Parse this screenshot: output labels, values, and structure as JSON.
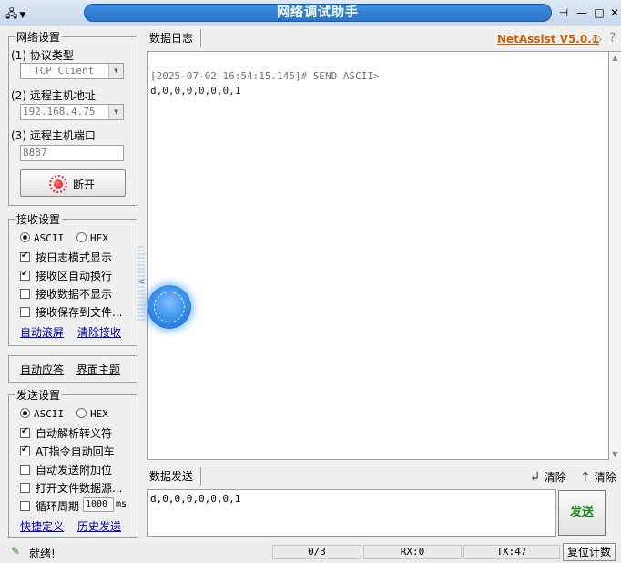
{
  "window": {
    "title": "网络调试助手"
  },
  "network_settings": {
    "group_title": "网络设置",
    "protocol_label": "(1) 协议类型",
    "protocol_value": "TCP Client",
    "remote_host_label": "(2) 远程主机地址",
    "remote_host_value": "192.168.4.75",
    "remote_port_label": "(3) 远程主机端口",
    "remote_port_value": "8887",
    "disconnect_label": "断开"
  },
  "receive_settings": {
    "group_title": "接收设置",
    "ascii_label": "ASCII",
    "hex_label": "HEX",
    "ascii_selected": true,
    "options": [
      {
        "label": "按日志模式显示",
        "checked": true
      },
      {
        "label": "接收区自动换行",
        "checked": true
      },
      {
        "label": "接收数据不显示",
        "checked": false
      },
      {
        "label": "接收保存到文件...",
        "checked": false
      }
    ],
    "auto_scroll_link": "自动滚屏",
    "clear_receive_link": "清除接收"
  },
  "misc_panel": {
    "auto_reply_link": "自动应答",
    "theme_link": "界面主题"
  },
  "send_settings": {
    "group_title": "发送设置",
    "ascii_label": "ASCII",
    "hex_label": "HEX",
    "ascii_selected": true,
    "options": [
      {
        "label": "自动解析转义符",
        "checked": true
      },
      {
        "label": "AT指令自动回车",
        "checked": true
      },
      {
        "label": "自动发送附加位",
        "checked": false
      },
      {
        "label": "打开文件数据源...",
        "checked": false
      }
    ],
    "loop_label": "循环周期",
    "loop_value": "1000",
    "loop_unit": "ms",
    "loop_checked": false,
    "shortcut_link": "快捷定义",
    "history_link": "历史发送"
  },
  "log": {
    "tab_label": "数据日志",
    "brand": "NetAssist V5.0.1",
    "header_line": "[2025-07-02 16:54:15.145]# SEND ASCII>",
    "body_line": "d,0,0,0,0,0,0,1"
  },
  "send_area": {
    "tab_label": "数据发送",
    "clear_log_label": "清除",
    "clear_send_label": "清除",
    "input_value": "d,0,0,0,0,0,0,1",
    "send_label": "发送"
  },
  "status_bar": {
    "status_text": "就绪!",
    "progress": "0/3",
    "rx": "RX:0",
    "tx": "TX:47",
    "reset_label": "复位计数"
  }
}
